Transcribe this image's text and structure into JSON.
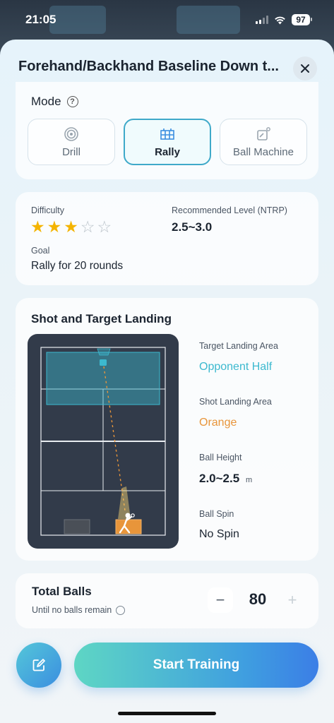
{
  "status_bar": {
    "time": "21:05",
    "battery": "97"
  },
  "sheet": {
    "title": "Forehand/Backhand Baseline Down t...",
    "close_icon": "close-icon"
  },
  "mode": {
    "label": "Mode",
    "help_icon": "?",
    "options": [
      {
        "label": "Drill",
        "icon": "target-icon",
        "active": false
      },
      {
        "label": "Rally",
        "icon": "court-icon",
        "active": true
      },
      {
        "label": "Ball Machine",
        "icon": "ball-machine-icon",
        "active": false
      }
    ]
  },
  "difficulty": {
    "label": "Difficulty",
    "stars_filled": 3,
    "stars_total": 5,
    "recommended_label": "Recommended Level (NTRP)",
    "recommended_value": "2.5~3.0",
    "goal_label": "Goal",
    "goal_value": "Rally for 20 rounds"
  },
  "shot": {
    "title": "Shot and Target Landing",
    "target_label": "Target Landing Area",
    "target_value": "Opponent Half",
    "shot_landing_label": "Shot Landing Area",
    "shot_landing_value": "Orange",
    "height_label": "Ball Height",
    "height_value": "2.0~2.5",
    "height_unit": "m",
    "spin_label": "Ball Spin",
    "spin_value": "No Spin",
    "colors": {
      "target": "#3cb9cf",
      "orange": "#e8953a"
    }
  },
  "balls": {
    "title": "Total Balls",
    "sub_label": "Until no balls remain",
    "value": "80",
    "minus": "−",
    "plus": "+"
  },
  "actions": {
    "start_label": "Start Training",
    "edit_icon": "edit-icon"
  }
}
